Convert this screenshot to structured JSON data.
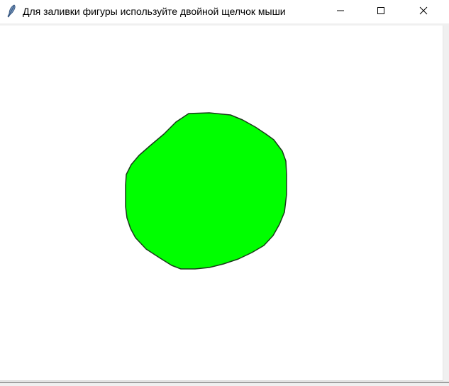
{
  "window": {
    "title": "Для заливки фигуры используйте двойной щелчок мыши",
    "app_icon": "feather-icon",
    "controls": {
      "minimize_icon": "minimize-icon",
      "maximize_icon": "maximize-icon",
      "close_icon": "close-icon"
    }
  },
  "canvas": {
    "background": "#ffffff",
    "shape": {
      "kind": "freehand-closed-shape",
      "fill": "#00ff00",
      "outline": "#1a3a1a"
    }
  }
}
